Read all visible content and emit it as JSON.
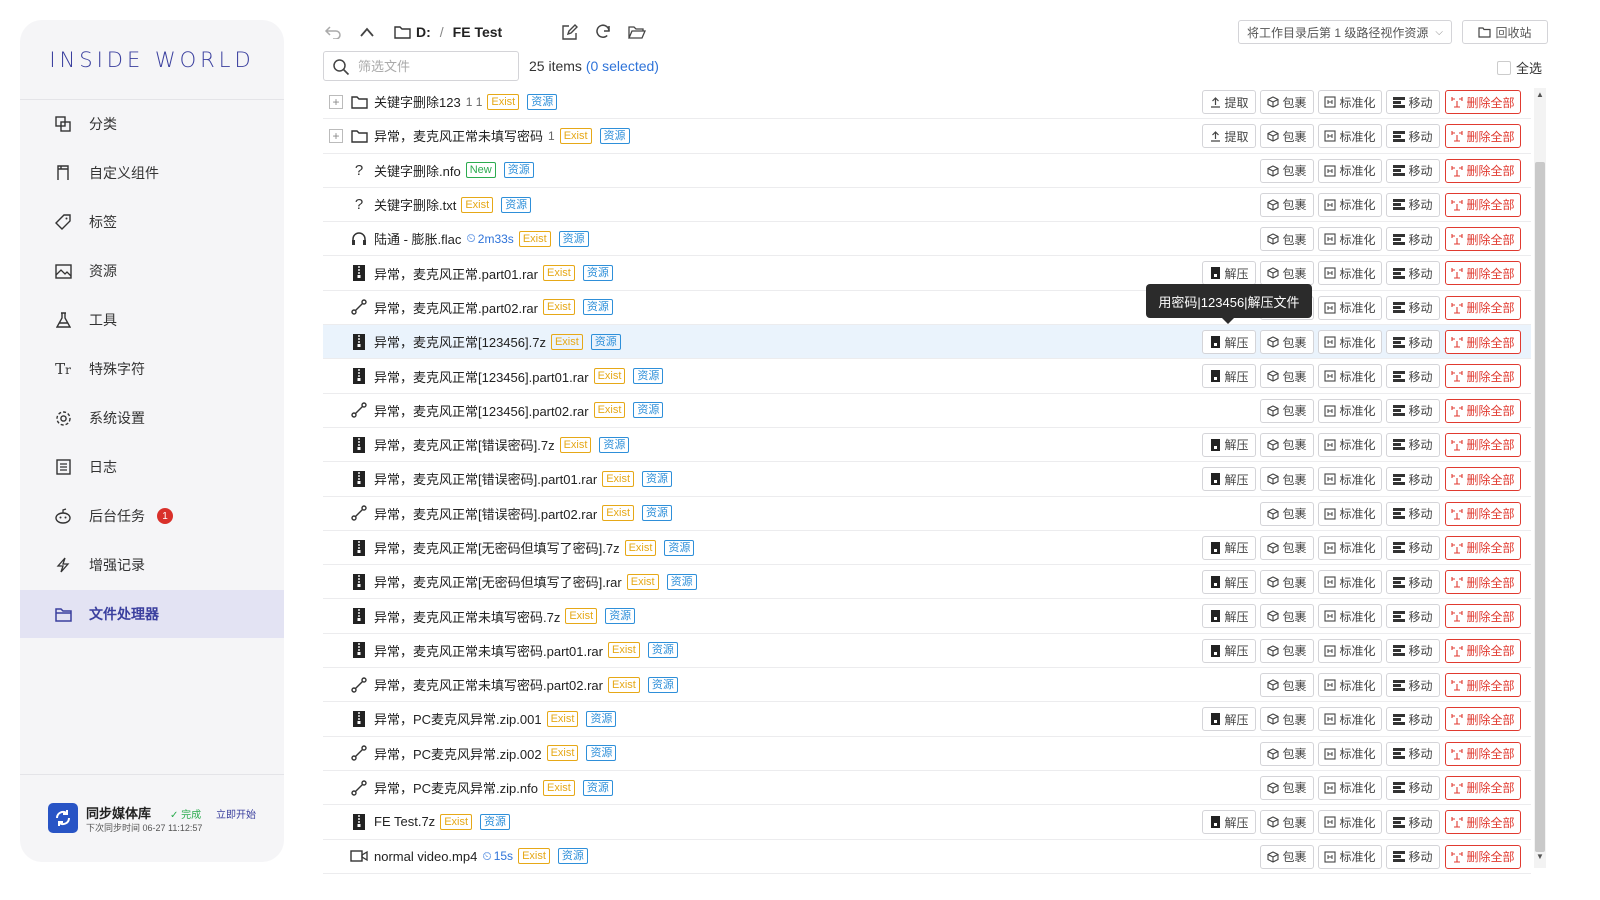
{
  "sidebar": {
    "logo": "INSIDE WORLD",
    "items": [
      {
        "label": "分类",
        "icon": "category-icon"
      },
      {
        "label": "自定义组件",
        "icon": "component-icon"
      },
      {
        "label": "标签",
        "icon": "tag-icon"
      },
      {
        "label": "资源",
        "icon": "image-icon"
      },
      {
        "label": "工具",
        "icon": "flask-icon"
      },
      {
        "label": "特殊字符",
        "icon": "text-icon"
      },
      {
        "label": "系统设置",
        "icon": "gear-icon"
      },
      {
        "label": "日志",
        "icon": "log-icon"
      },
      {
        "label": "后台任务",
        "icon": "robot-icon",
        "badge": "1"
      },
      {
        "label": "增强记录",
        "icon": "bolt-icon"
      },
      {
        "label": "文件处理器",
        "icon": "folder-tab-icon",
        "active": true
      }
    ],
    "sync": {
      "title": "同步媒体库",
      "status": "完成",
      "start": "立即开始",
      "next": "下次同步时间 06-27 11:12:57"
    }
  },
  "toolbar": {
    "drive": "D:",
    "separator": "/",
    "folder": "FE Test",
    "level_select": "将工作目录后第 1 级路径视作资源",
    "recycle": "回收站",
    "search_placeholder": "筛选文件",
    "items_count": "25 items",
    "selected": "(0 selected)",
    "select_all": "全选"
  },
  "actions": {
    "extract": "提取",
    "unzip": "解压",
    "pack": "包裹",
    "normalize": "标准化",
    "move": "移动",
    "delete_all": "删除全部"
  },
  "tags": {
    "exist": "Exist",
    "new": "New",
    "resource": "资源"
  },
  "tooltip": "用密码|123456|解压文件",
  "files": [
    {
      "name": "关键字删除123",
      "type": "folder",
      "meta": "1 1",
      "tag": "Exist",
      "extract": true
    },
    {
      "name": "异常，麦克风正常未填写密码",
      "type": "folder",
      "meta": "1",
      "tag": "Exist",
      "extract": true
    },
    {
      "name": "关键字删除.nfo",
      "type": "unknown",
      "tag": "New"
    },
    {
      "name": "关键字删除.txt",
      "type": "unknown",
      "tag": "Exist"
    },
    {
      "name": "陆通 - 膨胀.flac",
      "type": "audio",
      "duration": "2m33s",
      "tag": "Exist"
    },
    {
      "name": "异常，麦克风正常.part01.rar",
      "type": "archive",
      "tag": "Exist",
      "unzip": true
    },
    {
      "name": "异常，麦克风正常.part02.rar",
      "type": "link",
      "tag": "Exist"
    },
    {
      "name": "异常，麦克风正常[123456].7z",
      "type": "archive",
      "tag": "Exist",
      "unzip": true,
      "highlight": true
    },
    {
      "name": "异常，麦克风正常[123456].part01.rar",
      "type": "archive",
      "tag": "Exist",
      "unzip": true
    },
    {
      "name": "异常，麦克风正常[123456].part02.rar",
      "type": "link",
      "tag": "Exist"
    },
    {
      "name": "异常，麦克风正常[错误密码].7z",
      "type": "archive",
      "tag": "Exist",
      "unzip": true
    },
    {
      "name": "异常，麦克风正常[错误密码].part01.rar",
      "type": "archive",
      "tag": "Exist",
      "unzip": true
    },
    {
      "name": "异常，麦克风正常[错误密码].part02.rar",
      "type": "link",
      "tag": "Exist"
    },
    {
      "name": "异常，麦克风正常[无密码但填写了密码].7z",
      "type": "archive",
      "tag": "Exist",
      "unzip": true
    },
    {
      "name": "异常，麦克风正常[无密码但填写了密码].rar",
      "type": "archive",
      "tag": "Exist",
      "unzip": true
    },
    {
      "name": "异常，麦克风正常未填写密码.7z",
      "type": "archive",
      "tag": "Exist",
      "unzip": true
    },
    {
      "name": "异常，麦克风正常未填写密码.part01.rar",
      "type": "archive",
      "tag": "Exist",
      "unzip": true
    },
    {
      "name": "异常，麦克风正常未填写密码.part02.rar",
      "type": "link",
      "tag": "Exist"
    },
    {
      "name": "异常，PC麦克风异常.zip.001",
      "type": "archive",
      "tag": "Exist",
      "unzip": true
    },
    {
      "name": "异常，PC麦克风异常.zip.002",
      "type": "link",
      "tag": "Exist"
    },
    {
      "name": "异常，PC麦克风异常.zip.nfo",
      "type": "link",
      "tag": "Exist"
    },
    {
      "name": "FE Test.7z",
      "type": "archive",
      "tag": "Exist",
      "unzip": true
    },
    {
      "name": "normal video.mp4",
      "type": "video",
      "duration": "15s",
      "tag": "Exist"
    }
  ],
  "colors": {
    "accent": "#3a3f9e",
    "danger": "#e03a30",
    "exist": "#e6a817",
    "new": "#2bab4e",
    "link": "#2e73d9"
  }
}
